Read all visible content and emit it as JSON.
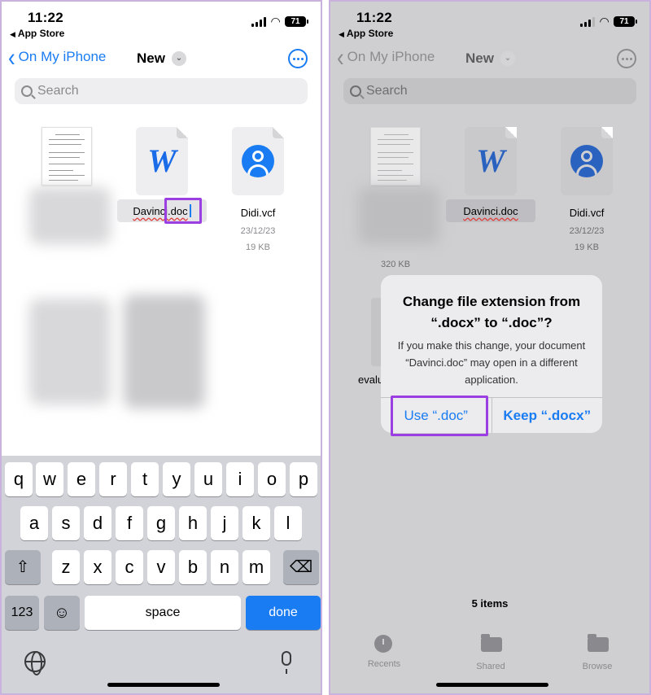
{
  "status_bar": {
    "time": "11:22",
    "back_app": "App Store",
    "battery": "71"
  },
  "nav": {
    "back_label": "On My iPhone",
    "title": "New"
  },
  "search": {
    "placeholder": "Search"
  },
  "left_panel": {
    "files": [
      {
        "name": "Davinci.doc",
        "type": "word",
        "renaming": true
      },
      {
        "name": "Didi.vcf",
        "type": "contact",
        "date": "23/12/23",
        "size": "19 KB"
      }
    ]
  },
  "keyboard": {
    "row1": [
      "q",
      "w",
      "e",
      "r",
      "t",
      "y",
      "u",
      "i",
      "o",
      "p"
    ],
    "row2": [
      "a",
      "s",
      "d",
      "f",
      "g",
      "h",
      "j",
      "k",
      "l"
    ],
    "row3": [
      "z",
      "x",
      "c",
      "v",
      "b",
      "n",
      "m"
    ],
    "numbers_key": "123",
    "space_key": "space",
    "done_key": "done"
  },
  "right_panel": {
    "files": [
      {
        "name": "Davinci.doc",
        "type": "word"
      },
      {
        "name": "Didi.vcf",
        "type": "contact",
        "date": "23/12/23",
        "size": "19 KB"
      }
    ],
    "blurred_file_size": "320 KB",
    "partial_file_name": "evalu",
    "alert": {
      "title": "Change file extension from “.docx” to “.doc”?",
      "message": "If you make this change, your document “Davinci.doc” may open in a different application.",
      "use_button": "Use “.doc”",
      "keep_button": "Keep “.docx”"
    },
    "items_count": "5 items",
    "tabs": [
      {
        "label": "Recents",
        "icon": "clock-icon"
      },
      {
        "label": "Shared",
        "icon": "shared-folder-icon"
      },
      {
        "label": "Browse",
        "icon": "folder-icon"
      }
    ]
  },
  "colors": {
    "accent": "#1a7cf2",
    "highlight": "#9b3fe2",
    "spellcheck": "#e0403b"
  }
}
